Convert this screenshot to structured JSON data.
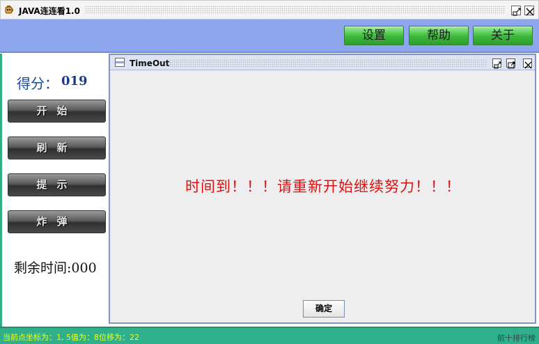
{
  "window": {
    "title": "JAVA连连看1.0",
    "icon": "teapot-icon"
  },
  "toolbar": {
    "settings": "设置",
    "help": "帮助",
    "about": "关于"
  },
  "sidebar": {
    "score_label": "得分：",
    "score_value": "019",
    "buttons": {
      "start": "开始",
      "refresh": "刷新",
      "hint": "提示",
      "bomb": "炸弹"
    },
    "time_label": "剩余时间:000"
  },
  "dialog": {
    "title": "TimeOut",
    "message": "时间到！！！请重新开始继续努力！！！",
    "ok_label": "确定"
  },
  "status": {
    "text": "当前点坐标为：1, 5值为：8位移为：22",
    "right": "前十排行榜"
  },
  "colors": {
    "topbar": "#8ea6ee",
    "accent_green": "#2fb08a",
    "message_red": "#dd1111",
    "score_blue": "#1a4a9a"
  }
}
